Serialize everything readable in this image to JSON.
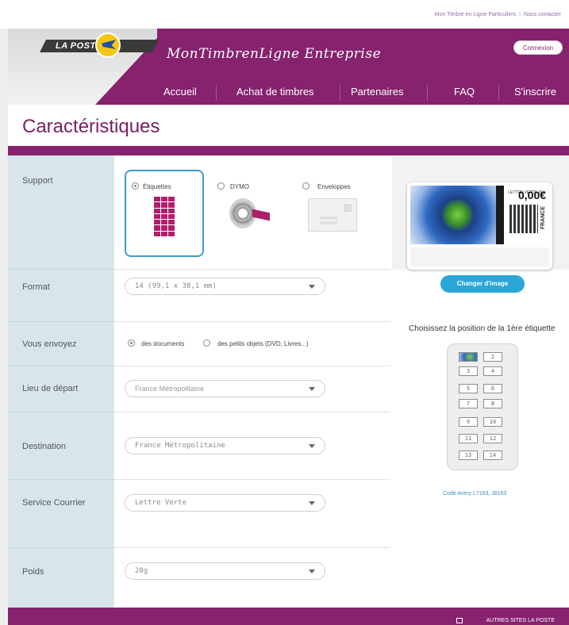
{
  "top_links": [
    "Mon Timbre en Ligne Particuliers",
    "Nous contacter"
  ],
  "header": {
    "logo_text": "LA POSTE",
    "brand": "MonTimbrenLigne Entreprise",
    "login_button": "Connexion",
    "nav": [
      "Accueil",
      "Achat de timbres",
      "Partenaires",
      "FAQ",
      "S'inscrire"
    ]
  },
  "page_title": "Caractéristiques",
  "form": {
    "support": {
      "label": "Support",
      "options": [
        {
          "label": "Étiquettes",
          "selected": true
        },
        {
          "label": "DYMO",
          "selected": false
        },
        {
          "label": "Enveloppes",
          "selected": false
        }
      ]
    },
    "format": {
      "label": "Format",
      "value": "14 (99,1 x 38,1 mm)"
    },
    "envoi": {
      "label": "Vous envoyez",
      "options": [
        {
          "label": "des documents",
          "selected": true
        },
        {
          "label": "des petits objets (DVD, Livres...)",
          "selected": false
        }
      ]
    },
    "depart": {
      "label": "Lieu de départ",
      "value": "France Métropolitaine"
    },
    "destination": {
      "label": "Destination",
      "value": "France Métropolitaine"
    },
    "service": {
      "label": "Service Courrier",
      "value": "Lettre Verte"
    },
    "poids": {
      "label": "Poids",
      "value": "20g"
    }
  },
  "preview": {
    "price": "0,00€",
    "small_text": "LETTRE VERTE 20g",
    "country": "FRANCE",
    "change_image_button": "Changer d'image",
    "choose_position": "Choisissez la position de la 1ère étiquette",
    "positions": [
      "1",
      "2",
      "3",
      "4",
      "5",
      "6",
      "7",
      "8",
      "9",
      "10",
      "11",
      "12",
      "13",
      "14"
    ],
    "selected_position": 1,
    "code_avery": "Code Avery L7163, J8163"
  },
  "footer": {
    "link": "AUTRES SITES LA POSTE"
  },
  "colors": {
    "brand_purple": "#86226e",
    "accent_blue": "#2aa7d6",
    "logo_yellow": "#f7c613"
  }
}
